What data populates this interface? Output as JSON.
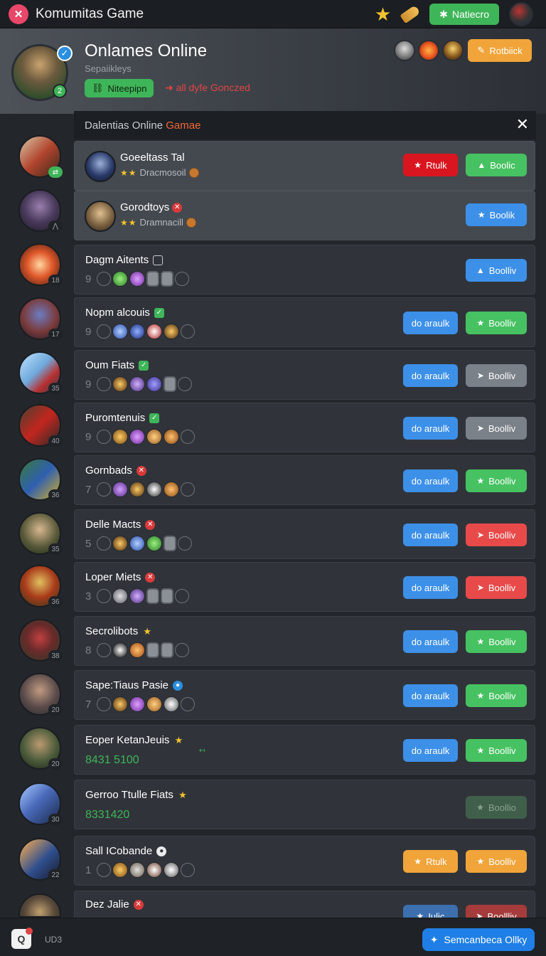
{
  "topbar": {
    "app_title": "Komumitas Game",
    "app_icon": "game-controller-icon",
    "notice_button": "Natiecro",
    "icons": [
      "star-icon",
      "bullet-icon",
      "user-avatar"
    ]
  },
  "profile": {
    "name": "Onlames Online",
    "subtitle": "Sepaiikleys",
    "level": "2",
    "network_button": "Niteepipn",
    "status_text": "all dyfe Gonczed",
    "action_button": "Rotbiick"
  },
  "dialog": {
    "title_prefix": "Dalentias Online ",
    "title_accent": "Gamae"
  },
  "featured_rows": [
    {
      "name": "Goeeltass Tal",
      "stars": "★★",
      "subtitle": "Dracmosoil",
      "left_button": "Rtulk",
      "right_button": "Boolic"
    },
    {
      "name": "Gorodtoys",
      "stars": "★★",
      "subtitle": "Dramnacill",
      "right_button": "Boolik"
    }
  ],
  "rows": [
    {
      "name": "Dagm Aitents",
      "count": "9",
      "right_button": "Boolliv"
    },
    {
      "name": "Nopm alcouis",
      "count": "9",
      "left_button": "do araulk",
      "right_button": "Boolliv"
    },
    {
      "name": "Oum Fiats",
      "count": "9",
      "left_button": "do araulk",
      "right_button": "Boolliv"
    },
    {
      "name": "Puromtenuis",
      "count": "9",
      "left_button": "do araulk",
      "right_button": "Boolliv"
    },
    {
      "name": "Gornbads",
      "count": "7",
      "left_button": "do araulk",
      "right_button": "Boolliv"
    },
    {
      "name": "Delle Macts",
      "count": "5",
      "left_button": "do araulk",
      "right_button": "Boolliv"
    },
    {
      "name": "Loper Miets",
      "count": "3",
      "left_button": "do araulk",
      "right_button": "Boolliv"
    },
    {
      "name": "Secrolibots",
      "count": "8",
      "left_button": "do araulk",
      "right_button": "Boolliv"
    },
    {
      "name": "Sape:Tiaus Pasie",
      "count": "7",
      "left_button": "do araulk",
      "right_button": "Boolliv"
    },
    {
      "name": "Eoper KetanJeuis",
      "score": "8431 5100",
      "left_button": "do araulk",
      "right_button": "Boolliv"
    },
    {
      "name": "Gerroo Ttulle Fiats",
      "score": "8331420",
      "right_button": "Boollio"
    },
    {
      "name": "Sall ICobande",
      "count": "1",
      "left_button": "Rtulk",
      "right_button": "Boolliv"
    },
    {
      "name": "Dez Jalie",
      "left_button": "Iulic",
      "right_button": "Boollliv"
    }
  ],
  "rail_badges": [
    "",
    "",
    "18",
    "17",
    "35",
    "40",
    "36",
    "35",
    "36",
    "38",
    "20",
    "20",
    "30",
    "22",
    ""
  ],
  "bottombar": {
    "label": "UD3",
    "search_button": "Semcanbeca Ollky"
  },
  "colors": {
    "green": "#47c262",
    "blue": "#3d90e8",
    "red": "#d9161f",
    "orange": "#f0a43a",
    "gray": "#7b8188"
  }
}
